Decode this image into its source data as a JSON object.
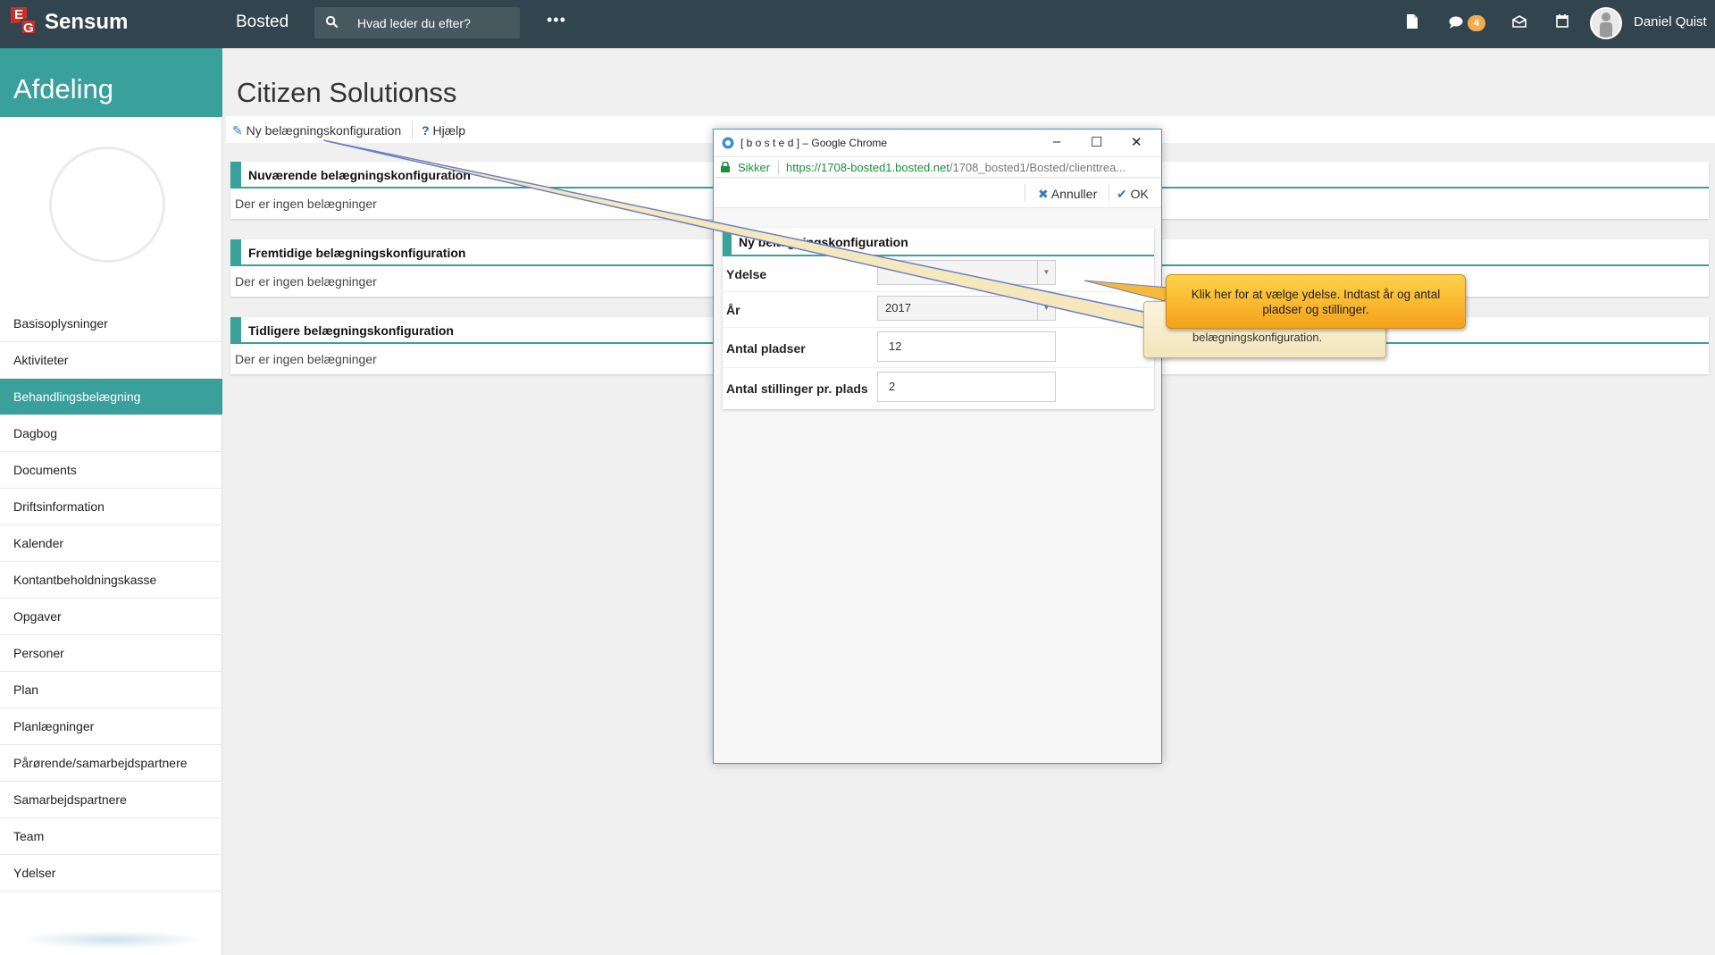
{
  "topbar": {
    "logo_letters": [
      "E",
      "G"
    ],
    "brand": "Sensum",
    "section": "Bosted",
    "search_placeholder": "Hvad leder du efter?",
    "more": "•••",
    "chat_badge": "4",
    "user_name": "Daniel Quist"
  },
  "sidebar": {
    "title": "Afdeling",
    "items": [
      "Basisoplysninger",
      "Aktiviteter",
      "Behandlingsbelægning",
      "Dagbog",
      "Documents",
      "Driftsinformation",
      "Kalender",
      "Kontantbeholdningskasse",
      "Opgaver",
      "Personer",
      "Plan",
      "Planlægninger",
      "Pårørende/samarbejdspartnere",
      "Samarbejdspartnere",
      "Team",
      "Ydelser"
    ],
    "active_index": 2
  },
  "main": {
    "title": "Citizen Solutionss",
    "toolbar": {
      "new_label": "Ny belægningskonfiguration",
      "help_label": "Hjælp"
    },
    "panels": [
      {
        "title": "Nuværende belægningskonfiguration",
        "body": "Der er ingen belægninger"
      },
      {
        "title": "Fremtidige belægningskonfiguration",
        "body": "Der er ingen belægninger"
      },
      {
        "title": "Tidligere belægningskonfiguration",
        "body": "Der er ingen belægninger"
      }
    ]
  },
  "popup": {
    "window_title": "[ b o s t e d ] – Google Chrome",
    "secure_label": "Sikker",
    "url_host": "https://1708-bosted1.bosted.net",
    "url_path": "/1708_bosted1/Bosted/clienttrea...",
    "cancel_label": "Annuller",
    "ok_label": "OK",
    "form_title": "Ny belægningskonfiguration",
    "fields": {
      "ydelse_label": "Ydelse",
      "ydelse_value": "",
      "year_label": "År",
      "year_value": "2017",
      "places_label": "Antal pladser",
      "places_value": "12",
      "positions_label": "Antal stillinger pr. plads",
      "positions_value": "2"
    }
  },
  "callouts": {
    "back_text": "belægningskonfiguration.",
    "front_text": "Klik her for at vælge ydelse. Indtast år og antal pladser og stillinger."
  },
  "colors": {
    "topbar": "#32444e",
    "accent": "#3aa09c",
    "badge": "#f0ad4e",
    "callout": "#f4a21b"
  }
}
